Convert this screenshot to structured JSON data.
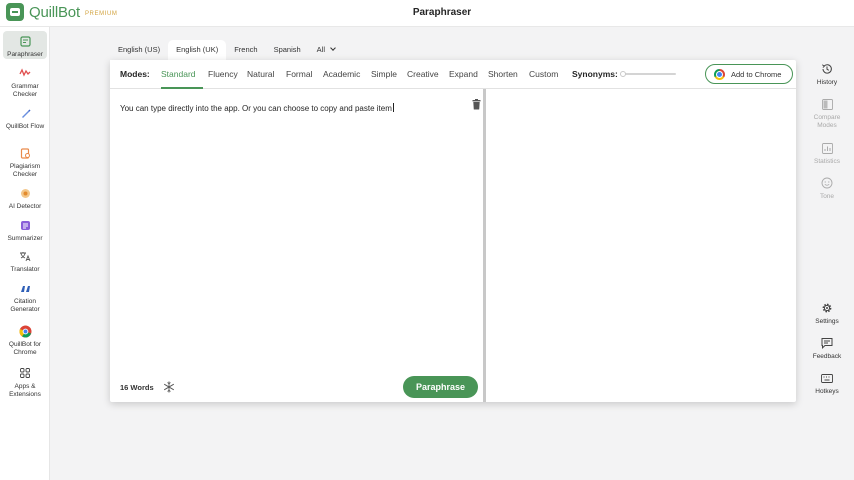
{
  "app": {
    "logo_text": "QuillBot",
    "logo_badge": "PREMIUM",
    "title": "Paraphraser"
  },
  "sidebar": {
    "items": [
      {
        "label": "Paraphraser",
        "icon": "paraphraser-icon",
        "active": true
      },
      {
        "label": "Grammar Checker",
        "icon": "grammar-icon"
      },
      {
        "label": "QuillBot Flow",
        "icon": "pen-icon"
      },
      {
        "label": "Plagiarism Checker",
        "icon": "plagiarism-icon"
      },
      {
        "label": "AI Detector",
        "icon": "ai-detector-icon"
      },
      {
        "label": "Summarizer",
        "icon": "summarizer-icon"
      },
      {
        "label": "Translator",
        "icon": "translate-icon"
      },
      {
        "label": "Citation Generator",
        "icon": "quote-icon"
      },
      {
        "label": "QuillBot for Chrome",
        "icon": "chrome-icon"
      },
      {
        "label": "Apps & Extensions",
        "icon": "apps-grid-icon"
      }
    ]
  },
  "right_rail": {
    "items": [
      {
        "label": "History",
        "icon": "history-icon"
      },
      {
        "label": "Compare Modes",
        "icon": "compare-icon",
        "disabled": true
      },
      {
        "label": "Statistics",
        "icon": "statistics-icon",
        "disabled": true
      },
      {
        "label": "Tone",
        "icon": "tone-icon",
        "disabled": true
      },
      {
        "label": "Settings",
        "icon": "gear-icon"
      },
      {
        "label": "Feedback",
        "icon": "feedback-icon"
      },
      {
        "label": "Hotkeys",
        "icon": "keyboard-icon"
      }
    ]
  },
  "language_tabs": {
    "tabs": [
      "English (US)",
      "English (UK)",
      "French",
      "Spanish",
      "All"
    ],
    "active": "English (UK)"
  },
  "modes": {
    "label": "Modes:",
    "items": [
      "Standard",
      "Fluency",
      "Natural",
      "Formal",
      "Academic",
      "Simple",
      "Creative",
      "Expand",
      "Shorten",
      "Custom"
    ],
    "active": "Standard",
    "synonyms_label": "Synonyms:",
    "synonyms_level": 0
  },
  "chrome_button": {
    "label": "Add to Chrome",
    "icon": "chrome-icon"
  },
  "editor": {
    "input_text": "You can type directly into the app. Or you can choose to copy and paste item",
    "word_count": "16 Words",
    "paraphrase_label": "Paraphrase"
  },
  "colors": {
    "brand_green": "#499557",
    "premium_gold": "#d2a33f",
    "background": "#f3f3f4"
  }
}
